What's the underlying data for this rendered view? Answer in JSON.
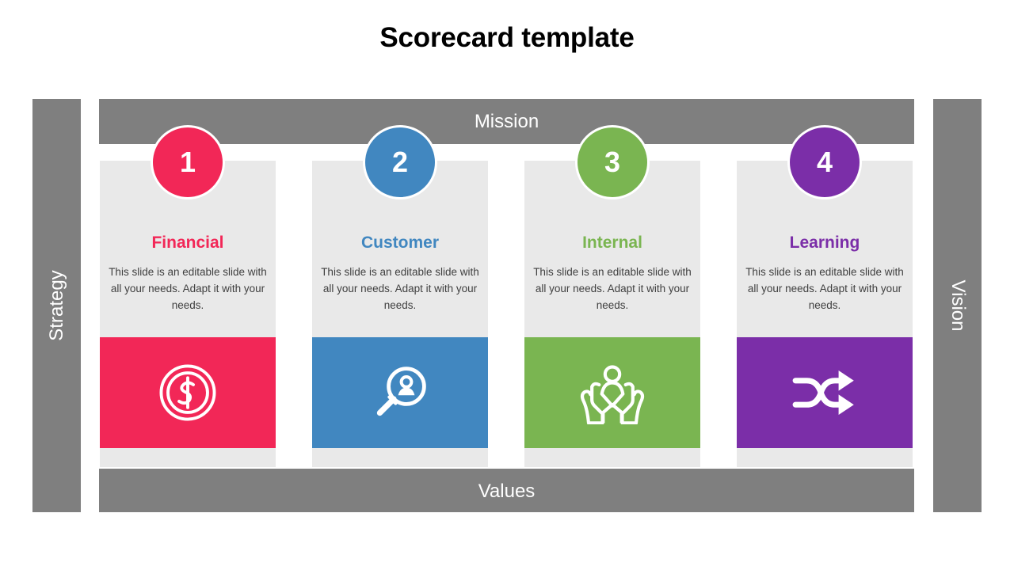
{
  "title": "Scorecard template",
  "bars": {
    "top_label": "Mission",
    "bottom_label": "Values",
    "left_label": "Strategy",
    "right_label": "Vision",
    "bar_color": "#7f7f7f"
  },
  "columns": [
    {
      "number": "1",
      "heading": "Financial",
      "body": "This slide is an editable slide with all your needs. Adapt it with your needs.",
      "color": "#f22757",
      "icon": "dollar-coin-icon"
    },
    {
      "number": "2",
      "heading": "Customer",
      "body": "This slide is an editable slide with all your needs. Adapt it with your needs.",
      "color": "#4187c0",
      "icon": "user-search-icon"
    },
    {
      "number": "3",
      "heading": "Internal",
      "body": "This slide is an editable slide with all your needs. Adapt it with your needs.",
      "color": "#7ab551",
      "icon": "hands-holding-person-icon"
    },
    {
      "number": "4",
      "heading": "Learning",
      "body": "This slide is an editable slide with all your needs. Adapt it with your needs.",
      "color": "#7b2ea8",
      "icon": "shuffle-arrows-icon"
    }
  ],
  "card_background": "#e9e9e9"
}
